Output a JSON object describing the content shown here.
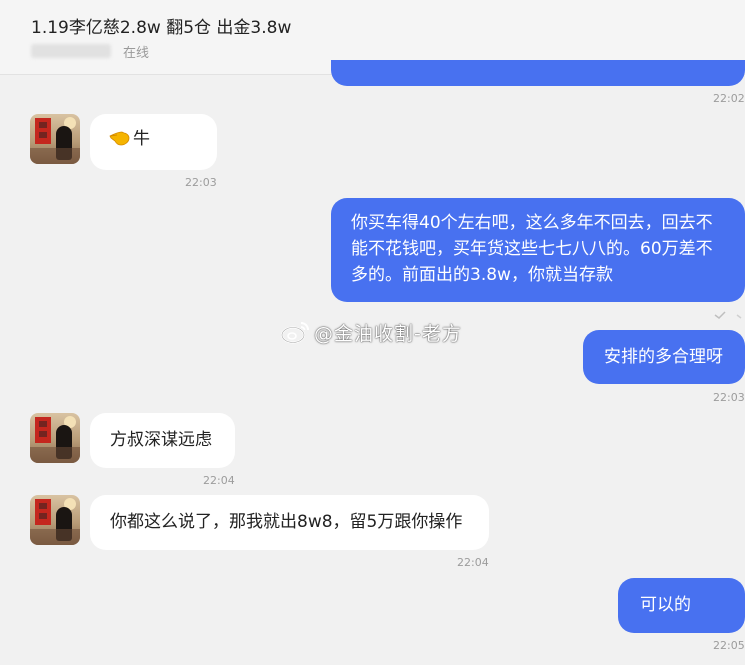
{
  "header": {
    "title": "1.19李亿慈2.8w 翻5仓 出金3.8w",
    "status": "在线"
  },
  "watermark": {
    "text": "@金油收割-老方",
    "icon": "weibo-logo"
  },
  "messages": [
    {
      "id": "m0",
      "direction": "out",
      "text": "",
      "time": "22:02"
    },
    {
      "id": "m1",
      "direction": "in",
      "icon": "pointing-hand-emoji",
      "text": "牛",
      "time": "22:03"
    },
    {
      "id": "m2",
      "direction": "out",
      "text": "你买车得40个左右吧，这么多年不回去，回去不能不花钱吧，买年货这些七七八八的。60万差不多的。前面出的3.8w，你就当存款",
      "time": ""
    },
    {
      "id": "m3",
      "direction": "out",
      "text": "安排的多合理呀",
      "time": "22:03"
    },
    {
      "id": "m4",
      "direction": "in",
      "text": "方叔深谋远虑",
      "time": "22:04"
    },
    {
      "id": "m5",
      "direction": "in",
      "text": "你都这么说了，那我就出8w8，留5万跟你操作",
      "time": "22:04"
    },
    {
      "id": "m6",
      "direction": "out",
      "text": "可以的",
      "time": "22:05"
    }
  ],
  "colors": {
    "outgoing_bubble": "#4871f0",
    "incoming_bubble": "#ffffff",
    "background": "#f1f1f1"
  }
}
